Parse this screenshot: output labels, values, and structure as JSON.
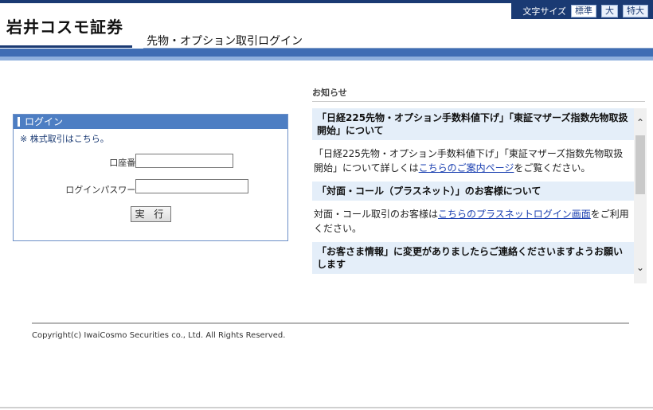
{
  "header": {
    "logo_text": "岩井コスモ証券",
    "page_title": "先物・オプション取引ログイン",
    "font_size_label": "文字サイズ",
    "font_size_options": [
      "標準",
      "大",
      "特大"
    ]
  },
  "login": {
    "panel_title": "ログイン",
    "stock_link": "※ 株式取引はこちら。",
    "account_label": "口座番号:",
    "password_label": "ログインパスワード:",
    "account_value": "",
    "password_value": "",
    "submit_label": "実 行"
  },
  "notice": {
    "title": "お知らせ",
    "items": [
      {
        "heading": "「日経225先物・オプション手数料値下げ」「東証マザーズ指数先物取扱開始」について",
        "body_pre": "「日経225先物・オプション手数料値下げ」「東証マザーズ指数先物取扱開始」について詳しくは",
        "link": "こちらのご案内ページ",
        "body_post": "をご覧ください。"
      },
      {
        "heading": "「対面・コール（プラスネット）」のお客様について",
        "body_pre": "対面・コール取引のお客様は",
        "link": "こちらのプラスネットログイン画面",
        "body_post": "をご利用ください。"
      },
      {
        "heading": "「お客さま情報」に変更がありましたらご連絡くださいますようお願いします",
        "body_pre": "",
        "link": "",
        "body_post": ""
      }
    ]
  },
  "footer": {
    "copyright": "Copyright(c) IwaiCosmo Securities co., Ltd. All Rights Reserved."
  },
  "colors": {
    "brand_navy": "#1a3a73",
    "brand_blue": "#3f6db4",
    "panel_header": "#4d7ec3",
    "notice_head_bg": "#e4eef9"
  }
}
